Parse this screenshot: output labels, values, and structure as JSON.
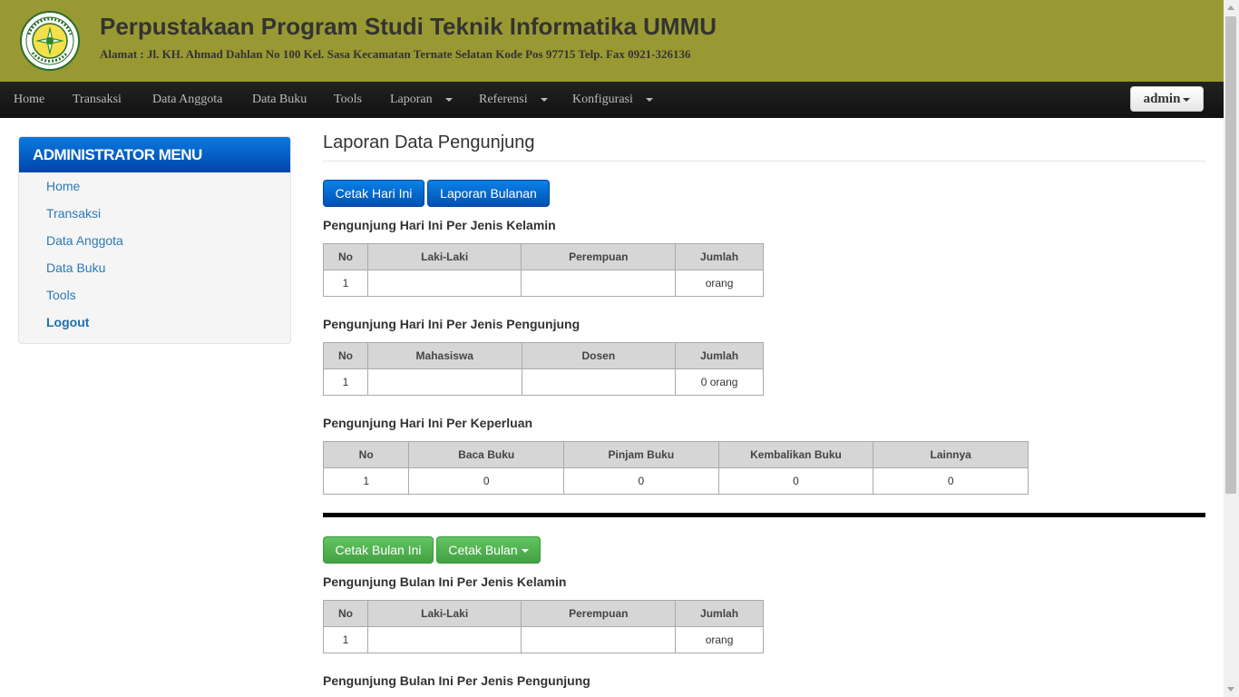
{
  "header": {
    "title": "Perpustakaan Program Studi Teknik Informatika UMMU",
    "address": "Alamat : Jl. KH. Ahmad Dahlan No 100 Kel. Sasa Kecamatan Ternate Selatan Kode Pos 97715 Telp. Fax 0921-326136",
    "logo_text_top": "UNIVERSITAS MUHAMMADIYAH",
    "logo_text_bottom": "MALUKU UTARA"
  },
  "navbar": {
    "items": [
      {
        "label": "Home"
      },
      {
        "label": "Transaksi"
      },
      {
        "label": "Data Anggota"
      },
      {
        "label": "Data Buku"
      },
      {
        "label": "Tools"
      },
      {
        "label": "Laporan"
      },
      {
        "label": "Referensi"
      },
      {
        "label": "Konfigurasi"
      }
    ],
    "user_label": "admin"
  },
  "sidebar": {
    "heading": "ADMINISTRATOR MENU",
    "items": [
      {
        "label": "Home"
      },
      {
        "label": "Transaksi"
      },
      {
        "label": "Data Anggota"
      },
      {
        "label": "Data Buku"
      },
      {
        "label": "Tools"
      },
      {
        "label": "Logout"
      }
    ]
  },
  "main": {
    "title": "Laporan Data Pengunjung",
    "buttons_daily": {
      "print_today": "Cetak Hari Ini",
      "monthly_report": "Laporan Bulanan"
    },
    "buttons_monthly": {
      "print_this_month": "Cetak Bulan Ini",
      "print_month": "Cetak Bulan"
    },
    "daily_gender": {
      "title": "Pengunjung Hari Ini Per Jenis Kelamin",
      "headers": [
        "No",
        "Laki-Laki",
        "Perempuan",
        "Jumlah"
      ],
      "row": [
        "1",
        "",
        "",
        "orang"
      ]
    },
    "daily_type": {
      "title": "Pengunjung Hari Ini Per Jenis Pengunjung",
      "headers": [
        "No",
        "Mahasiswa",
        "Dosen",
        "Jumlah"
      ],
      "row": [
        "1",
        "",
        "",
        "0 orang"
      ]
    },
    "daily_purpose": {
      "title": "Pengunjung Hari Ini Per Keperluan",
      "headers": [
        "No",
        "Baca Buku",
        "Pinjam Buku",
        "Kembalikan Buku",
        "Lainnya"
      ],
      "row": [
        "1",
        "0",
        "0",
        "0",
        "0"
      ]
    },
    "monthly_gender": {
      "title": "Pengunjung Bulan Ini Per Jenis Kelamin",
      "headers": [
        "No",
        "Laki-Laki",
        "Perempuan",
        "Jumlah"
      ],
      "row": [
        "1",
        "",
        "",
        "orang"
      ]
    },
    "monthly_type": {
      "title": "Pengunjung Bulan Ini Per Jenis Pengunjung"
    }
  },
  "colors": {
    "header_bg": "#999933",
    "navbar_bg": "#1a1a1a",
    "sidebar_head": "#0a6fd6",
    "primary_button": "#0a6fd6",
    "success_button": "#52b352",
    "link": "#2a7ab8"
  },
  "icons": {
    "logo": "university-seal-icon",
    "dropdown": "caret-down-icon"
  }
}
